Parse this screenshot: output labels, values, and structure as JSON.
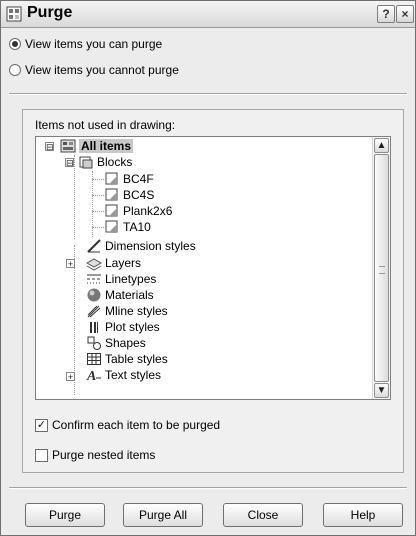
{
  "window": {
    "title": "Purge",
    "help_glyph": "?",
    "close_glyph": "×"
  },
  "view_options": [
    {
      "label": "View items you can purge",
      "selected": true
    },
    {
      "label": "View items you cannot purge",
      "selected": false
    }
  ],
  "tree": {
    "group_label": "Items not used in drawing:",
    "root": {
      "label": "All items",
      "expander": "⊟"
    },
    "blocks": {
      "label": "Blocks",
      "expander": "⊟",
      "children": [
        "BC4F",
        "BC4S",
        "Plank2x6",
        "TA10"
      ]
    },
    "items": [
      {
        "label": "Dimension styles",
        "icon": "dimension-icon",
        "expandable": false
      },
      {
        "label": "Layers",
        "icon": "layers-icon",
        "expandable": true
      },
      {
        "label": "Linetypes",
        "icon": "linetype-icon",
        "expandable": false
      },
      {
        "label": "Materials",
        "icon": "material-sphere-icon",
        "expandable": false
      },
      {
        "label": "Mline styles",
        "icon": "mline-icon",
        "expandable": false
      },
      {
        "label": "Plot styles",
        "icon": "plot-style-icon",
        "expandable": false
      },
      {
        "label": "Shapes",
        "icon": "shapes-icon",
        "expandable": false
      },
      {
        "label": "Table styles",
        "icon": "table-icon",
        "expandable": false
      },
      {
        "label": "Text styles",
        "icon": "text-style-icon",
        "expandable": true
      }
    ]
  },
  "scrollbar": {
    "up": "▲",
    "down": "▼"
  },
  "options": {
    "confirm": {
      "label": "Confirm each item to be purged",
      "checked": true,
      "mark": "✓"
    },
    "nested": {
      "label": "Purge nested items",
      "checked": false
    }
  },
  "buttons": {
    "purge": "Purge",
    "purge_all": "Purge All",
    "close": "Close",
    "help": "Help"
  },
  "colors": {
    "selection": "#c8c8c8",
    "dialog_bg": "#ececec"
  }
}
